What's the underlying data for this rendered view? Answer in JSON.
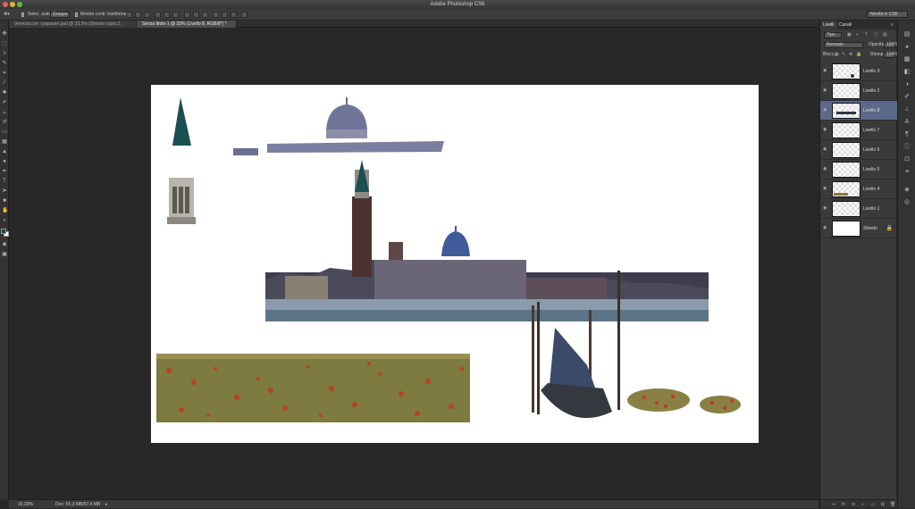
{
  "app": {
    "title": "Adobe Photoshop CS6",
    "workspace": "Novità in CS6"
  },
  "options": {
    "autoselect_label": "Selez. auto:",
    "autoselect_value": "Gruppo",
    "transform_label": "Mostra contr. trasformaz."
  },
  "tabs": [
    {
      "label": "Venezia con i papaveri.psd @ 33,3% (Sfondo copia 2, RGB/8*) *"
    },
    {
      "label": "Senza titolo-1 @ 33% (Livello 8, RGB/8*) *"
    }
  ],
  "status": {
    "zoom": "33,33%",
    "doc": "Doc: 55,3 MB/97,4 MB"
  },
  "panel": {
    "tabs": [
      "Livelli",
      "Canali"
    ],
    "filter": "Tipo",
    "blend_mode": "Normale",
    "opacity_label": "Opacità:",
    "opacity_value": "100%",
    "lock_label": "Blocc.:",
    "fill_label": "Riemp.:",
    "fill_value": "100%",
    "layers": [
      {
        "name": "Livello 3",
        "selected": false
      },
      {
        "name": "Livello 2",
        "selected": false
      },
      {
        "name": "Livello 8",
        "selected": true
      },
      {
        "name": "Livello 7",
        "selected": false
      },
      {
        "name": "Livello 6",
        "selected": false
      },
      {
        "name": "Livello 5",
        "selected": false
      },
      {
        "name": "Livello 4",
        "selected": false
      },
      {
        "name": "Livello 1",
        "selected": false
      },
      {
        "name": "Sfondo",
        "selected": false,
        "locked": true
      }
    ]
  },
  "icons": [
    "move-tool-icon",
    "marquee-tool-icon",
    "lasso-tool-icon",
    "quick-select-tool-icon",
    "crop-tool-icon",
    "eyedropper-tool-icon",
    "healing-brush-icon",
    "brush-tool-icon",
    "clone-stamp-icon",
    "history-brush-icon",
    "eraser-tool-icon",
    "gradient-tool-icon",
    "blur-tool-icon",
    "dodge-tool-icon",
    "pen-tool-icon",
    "type-tool-icon",
    "path-select-icon",
    "shape-tool-icon",
    "hand-tool-icon",
    "zoom-tool-icon"
  ],
  "colors": {
    "foreground": "#1f3f52",
    "background": "#ffffff",
    "selection": "#5b6a8a"
  }
}
